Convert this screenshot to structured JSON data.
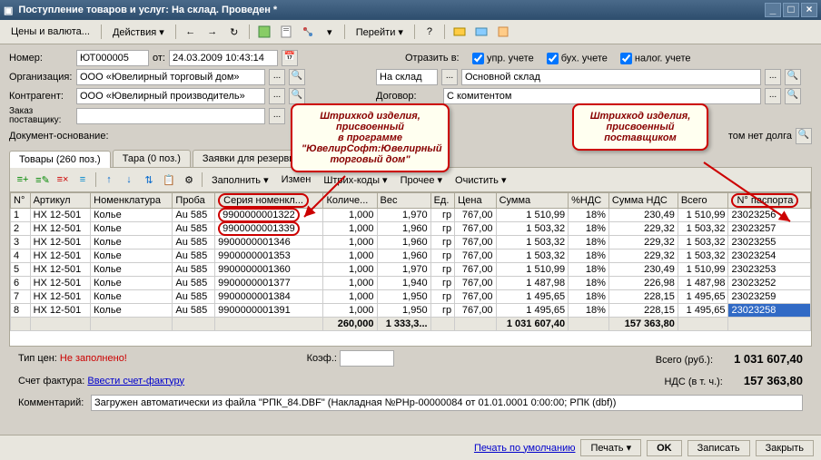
{
  "window": {
    "title": "Поступление товаров и услуг: На склад. Проведен *"
  },
  "menubar": {
    "prices": "Цены и валюта...",
    "actions": "Действия",
    "go": "Перейти"
  },
  "form": {
    "number_lbl": "Номер:",
    "number_val": "ЮТ000005",
    "from_lbl": "от:",
    "date_val": "24.03.2009 10:43:14",
    "reflect_lbl": "Отразить в:",
    "chk1": "упр. учете",
    "chk2": "бух. учете",
    "chk3": "налог. учете",
    "org_lbl": "Организация:",
    "org_val": "ООО «Ювелирный торговый дом»",
    "warehouse": "На склад",
    "main_warehouse": "Основной склад",
    "contr_lbl": "Контрагент:",
    "contr_val": "ООО «Ювелирный производитель»",
    "contract_lbl": "Договор:",
    "contract_val": "С комитентом",
    "order_lbl": "Заказ поставщику:",
    "doc_lbl": "Документ-основание:",
    "debt": "том нет долга"
  },
  "callouts": {
    "left": "Штрихкод изделия,\nприсвоенный\nв программе\n\"ЮвелирСофт:Ювелирный\nторговый дом\"",
    "right": "Штрихкод изделия,\nприсвоенный\nпоставщиком"
  },
  "tabs": {
    "goods": "Товары (260 поз.)",
    "tare": "Тара (0 поз.)",
    "reserve": "Заявки для резерви"
  },
  "tablebar": {
    "fill": "Заполнить",
    "change": "Измен",
    "barcode": "Штрих-коды",
    "other": "Прочее",
    "clear": "Очистить"
  },
  "grid": {
    "headers": [
      "N°",
      "Артикул",
      "Номенклатура",
      "Проба",
      "Серия номенкл...",
      "Количе...",
      "Вес",
      "Ед.",
      "Цена",
      "Сумма",
      "%НДС",
      "Сумма НДС",
      "Всего",
      "N° паспорта"
    ],
    "rows": [
      [
        "1",
        "НХ 12-501",
        "Колье",
        "Au 585",
        "9900000001322",
        "1,000",
        "1,970",
        "гр",
        "767,00",
        "1 510,99",
        "18%",
        "230,49",
        "1 510,99",
        "23023256"
      ],
      [
        "2",
        "НХ 12-501",
        "Колье",
        "Au 585",
        "9900000001339",
        "1,000",
        "1,960",
        "гр",
        "767,00",
        "1 503,32",
        "18%",
        "229,32",
        "1 503,32",
        "23023257"
      ],
      [
        "3",
        "НХ 12-501",
        "Колье",
        "Au 585",
        "9900000001346",
        "1,000",
        "1,960",
        "гр",
        "767,00",
        "1 503,32",
        "18%",
        "229,32",
        "1 503,32",
        "23023255"
      ],
      [
        "4",
        "НХ 12-501",
        "Колье",
        "Au 585",
        "9900000001353",
        "1,000",
        "1,960",
        "гр",
        "767,00",
        "1 503,32",
        "18%",
        "229,32",
        "1 503,32",
        "23023254"
      ],
      [
        "5",
        "НХ 12-501",
        "Колье",
        "Au 585",
        "9900000001360",
        "1,000",
        "1,970",
        "гр",
        "767,00",
        "1 510,99",
        "18%",
        "230,49",
        "1 510,99",
        "23023253"
      ],
      [
        "6",
        "НХ 12-501",
        "Колье",
        "Au 585",
        "9900000001377",
        "1,000",
        "1,940",
        "гр",
        "767,00",
        "1 487,98",
        "18%",
        "226,98",
        "1 487,98",
        "23023252"
      ],
      [
        "7",
        "НХ 12-501",
        "Колье",
        "Au 585",
        "9900000001384",
        "1,000",
        "1,950",
        "гр",
        "767,00",
        "1 495,65",
        "18%",
        "228,15",
        "1 495,65",
        "23023259"
      ],
      [
        "8",
        "НХ 12-501",
        "Колье",
        "Au 585",
        "9900000001391",
        "1,000",
        "1,950",
        "гр",
        "767,00",
        "1 495,65",
        "18%",
        "228,15",
        "1 495,65",
        "23023258"
      ]
    ],
    "totals": [
      "",
      "",
      "",
      "",
      "",
      "260,000",
      "1 333,3...",
      "",
      "",
      "1 031 607,40",
      "",
      "157 363,80",
      "",
      ""
    ]
  },
  "footer": {
    "price_type_lbl": "Тип цен:",
    "price_type_val": "Не заполнено!",
    "coef": "Коэф.:",
    "total_lbl": "Всего (руб.):",
    "total_val": "1 031 607,40",
    "invoice_lbl": "Счет фактура:",
    "invoice_link": "Ввести счет-фактуру",
    "vat_lbl": "НДС (в т. ч.):",
    "vat_val": "157 363,80",
    "comment_lbl": "Комментарий:",
    "comment_val": "Загружен автоматически из файла \"РПК_84.DBF\" (Накладная №РНр-00000084 от 01.01.0001 0:00:00; РПК (dbf))"
  },
  "bottom": {
    "print_def": "Печать по умолчанию",
    "print": "Печать",
    "ok": "OK",
    "save": "Записать",
    "close": "Закрыть"
  }
}
